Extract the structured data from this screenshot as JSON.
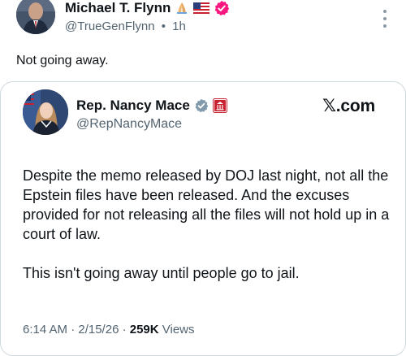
{
  "outer_post": {
    "author_name": "Michael T. Flynn",
    "handle": "@TrueGenFlynn",
    "separator": "•",
    "time": "1h",
    "text": "Not going away.",
    "badges": [
      "praying-hands-emoji",
      "us-flag-emoji",
      "verified-badge"
    ]
  },
  "quoted_post": {
    "author_name": "Rep. Nancy Mace",
    "handle": "@RepNancyMace",
    "source": "𝕏.com",
    "badges": [
      "gray-verified-badge",
      "house-seal-badge"
    ],
    "paragraph_1": "Despite the memo released by DOJ last night, not all the Epstein files have been released. And the excuses provided for not releasing all the files will not hold up in a court of law.",
    "paragraph_2": "This isn't going away until people go to jail.",
    "timestamp": "6:14 AM · 2/15/26 · ",
    "views_count": "259K",
    "views_label": " Views"
  },
  "colors": {
    "text_primary": "#0f1419",
    "text_secondary": "#536471",
    "border": "#cfd9de",
    "verified_pink": "#f91880",
    "verified_gray": "#829aab",
    "seal_red": "#c8202f"
  }
}
